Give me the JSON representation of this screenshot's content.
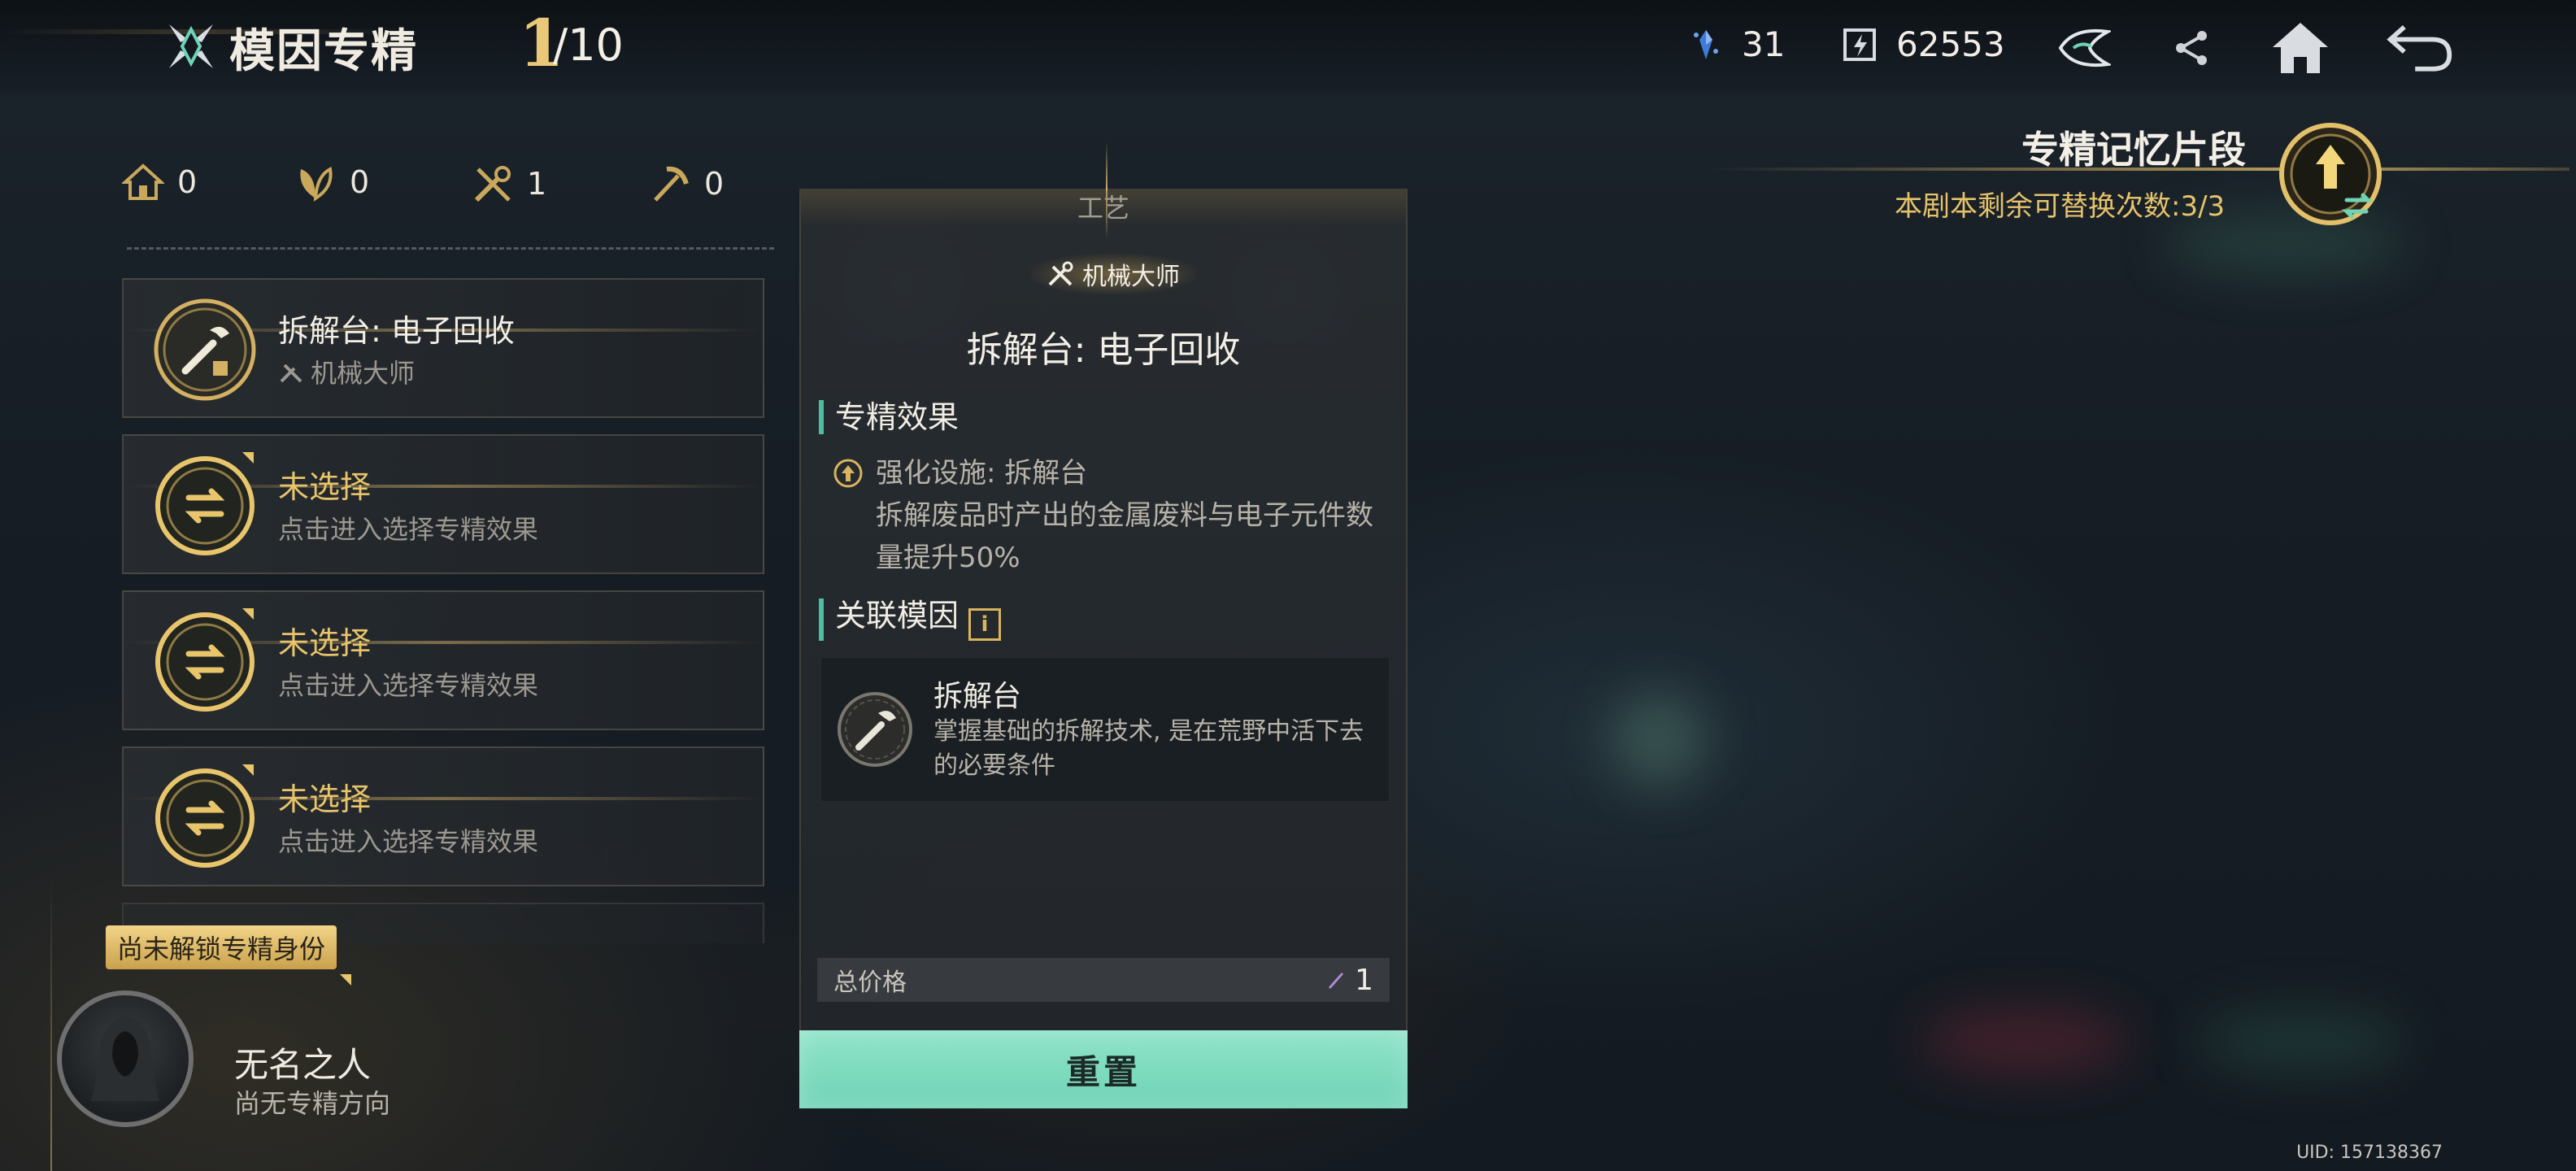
{
  "header": {
    "title": "模因专精",
    "progress_current": "1",
    "progress_total": "/10",
    "resource_1_value": "31",
    "resource_2_value": "62553",
    "buttons": [
      "mask-icon",
      "share-icon",
      "home-icon",
      "back-icon"
    ]
  },
  "stats": [
    {
      "icon": "house-icon",
      "value": "0"
    },
    {
      "icon": "leaf-icon",
      "value": "0"
    },
    {
      "icon": "tools-icon",
      "value": "1"
    },
    {
      "icon": "pickaxe-icon",
      "value": "0"
    }
  ],
  "slots": [
    {
      "title": "拆解台: 电子回收",
      "subtitle": "机械大师",
      "selected": true
    },
    {
      "title": "未选择",
      "subtitle": "点击进入选择专精效果",
      "selected": false
    },
    {
      "title": "未选择",
      "subtitle": "点击进入选择专精效果",
      "selected": false
    },
    {
      "title": "未选择",
      "subtitle": "点击进入选择专精效果",
      "selected": false
    }
  ],
  "profile": {
    "unlock_badge": "尚未解锁专精身份",
    "name": "无名之人",
    "subtitle": "尚无专精方向"
  },
  "detail": {
    "category": "工艺",
    "tag": "机械大师",
    "name": "拆解台: 电子回收",
    "effect_heading": "专精效果",
    "effect_line1": "强化设施: 拆解台",
    "effect_line2": "拆解废品时产出的金属废料与电子元件数量提升50%",
    "related_heading": "关联模因",
    "gene_title": "拆解台",
    "gene_desc": "掌握基础的拆解技术, 是在荒野中活下去的必要条件",
    "price_label": "总价格",
    "price_value": "1",
    "reset_label": "重置"
  },
  "memory": {
    "title": "专精记忆片段",
    "subtitle": "本剧本剩余可替换次数:3/3"
  },
  "footer": {
    "uid": "UID: 157138367"
  },
  "colors": {
    "accent_gold": "#e8c56b",
    "accent_teal": "#6fd3b5",
    "background": "#151b22"
  }
}
